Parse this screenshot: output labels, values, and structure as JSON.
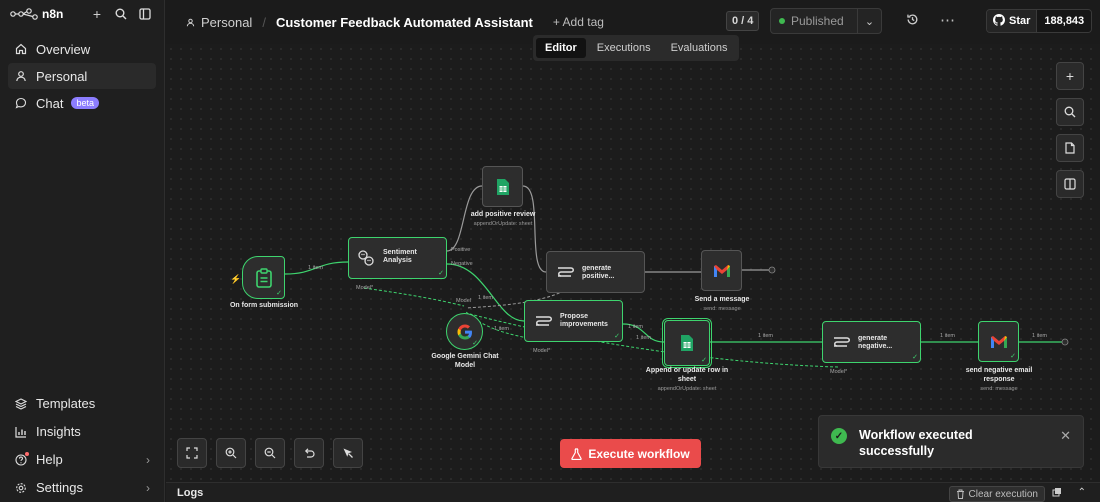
{
  "app": {
    "logo_text": "n8n"
  },
  "sidebar": {
    "items": [
      {
        "label": "Overview",
        "icon": "home-icon"
      },
      {
        "label": "Personal",
        "icon": "user-icon"
      },
      {
        "label": "Chat",
        "icon": "chat-icon",
        "badge": "beta"
      }
    ],
    "bottom_items": [
      {
        "label": "Templates",
        "icon": "templates-icon"
      },
      {
        "label": "Insights",
        "icon": "insights-icon"
      },
      {
        "label": "Help",
        "icon": "help-icon"
      },
      {
        "label": "Settings",
        "icon": "settings-icon"
      }
    ]
  },
  "header": {
    "breadcrumb_project": "Personal",
    "workflow_title": "Customer Feedback Automated Assistant",
    "add_tag": "+ Add tag",
    "counter": "0 / 4",
    "status": "Published",
    "github_star": "Star",
    "github_count": "188,843"
  },
  "tabs": [
    {
      "label": "Editor",
      "active": true
    },
    {
      "label": "Executions",
      "active": false
    },
    {
      "label": "Evaluations",
      "active": false
    }
  ],
  "nodes": {
    "form": {
      "label": "On form submission"
    },
    "sentiment": {
      "title": "Sentiment Analysis"
    },
    "add_positive": {
      "label": "add positive review",
      "sub": "appendOrUpdate: sheet"
    },
    "gen_positive": {
      "title": "generate positive..."
    },
    "send_message": {
      "label": "Send a message",
      "sub": "send: message"
    },
    "gemini": {
      "label": "Google Gemini Chat Model"
    },
    "propose": {
      "title": "Propose improvements"
    },
    "append_row": {
      "label": "Append or update row in sheet",
      "sub": "appendOrUpdate: sheet"
    },
    "gen_negative": {
      "title": "generate negative..."
    },
    "send_negative": {
      "label": "send negative email response",
      "sub": "send: message"
    }
  },
  "edge_labels": {
    "one_item": "1 item",
    "positive": "Positive",
    "negative": "Negative",
    "model": "Model",
    "model_req": "Model*"
  },
  "canvas": {
    "execute_button": "Execute workflow",
    "toast_message": "Workflow executed successfully"
  },
  "logs": {
    "title": "Logs",
    "clear": "Clear execution"
  },
  "colors": {
    "accent_green": "#3ed46e",
    "execute_red": "#ea4b4b",
    "beta_badge": "#8c7dff"
  }
}
